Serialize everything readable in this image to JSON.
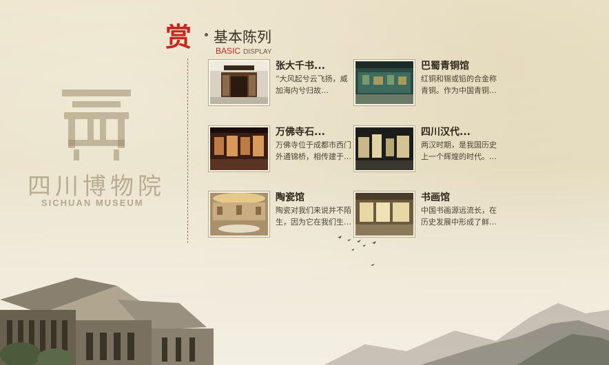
{
  "museum": {
    "name_cn": "四川博物院",
    "name_en": "SICHUAN MUSEUM"
  },
  "header": {
    "badge": "赏",
    "title": "基本陈列",
    "sub_a": "BASIC",
    "sub_b": "DISPLAY"
  },
  "items": [
    {
      "title": "张大千书...",
      "desc": "“大风起兮云飞扬，威加海内兮归故…",
      "icon": "gallery-entrance-photo"
    },
    {
      "title": "巴蜀青铜馆",
      "desc": "红铜和锡或铅的合金称青铜。作为中国青铜…",
      "icon": "bronze-hall-photo"
    },
    {
      "title": "万佛寺石...",
      "desc": "万佛寺位于成都市西门外通锦桥，相传建于…",
      "icon": "stone-carving-hall-photo"
    },
    {
      "title": "四川汉代...",
      "desc": "两汉时期，是我国历史上一个辉煌的时代。…",
      "icon": "han-dynasty-hall-photo"
    },
    {
      "title": "陶瓷馆",
      "desc": "陶瓷对我们来说并不陌生，因为它在我们生…",
      "icon": "ceramics-hall-photo"
    },
    {
      "title": "书画馆",
      "desc": "中国书画源远流长，在历史发展中形成了鲜…",
      "icon": "calligraphy-painting-hall-photo"
    }
  ],
  "colors": {
    "accent_red": "#c8261a",
    "text_dark": "#2f261a",
    "paper": "#e8dfc4"
  }
}
